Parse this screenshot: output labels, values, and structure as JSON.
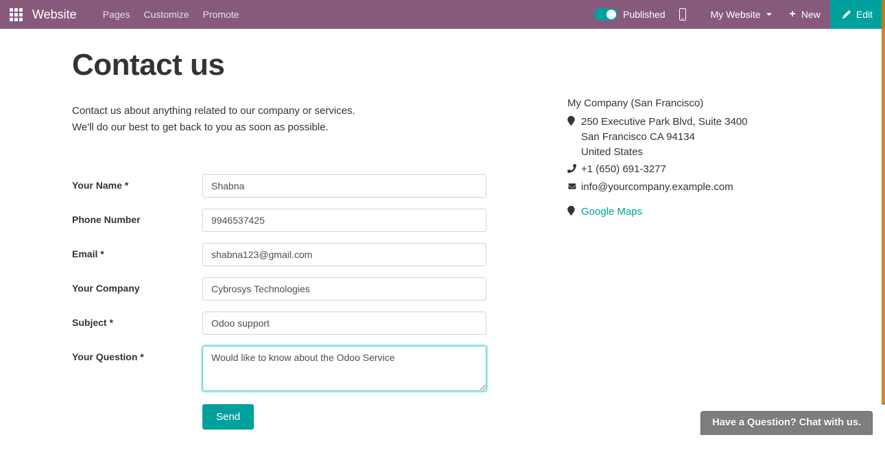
{
  "navbar": {
    "brand": "Website",
    "items": [
      "Pages",
      "Customize",
      "Promote"
    ],
    "published_label": "Published",
    "site_dropdown": "My Website",
    "new_label": "New",
    "edit_label": "Edit"
  },
  "page": {
    "title": "Contact us",
    "intro_line1": "Contact us about anything related to our company or services.",
    "intro_line2": "We'll do our best to get back to you as soon as possible."
  },
  "form": {
    "fields": {
      "name": {
        "label": "Your Name *",
        "value": "Shabna"
      },
      "phone": {
        "label": "Phone Number",
        "value": "9946537425"
      },
      "email": {
        "label": "Email *",
        "value": "shabna123@gmail.com"
      },
      "company": {
        "label": "Your Company",
        "value": "Cybrosys Technologies"
      },
      "subject": {
        "label": "Subject *",
        "value": "Odoo support"
      },
      "question": {
        "label": "Your Question *",
        "value": "Would like to know about the Odoo Service"
      }
    },
    "send_label": "Send"
  },
  "company": {
    "name": "My Company (San Francisco)",
    "address_line1": "250 Executive Park Blvd, Suite 3400",
    "address_line2": "San Francisco CA 94134",
    "address_line3": "United States",
    "phone": "+1 (650) 691-3277",
    "email": "info@yourcompany.example.com",
    "maps_label": "Google Maps"
  },
  "chat": {
    "label": "Have a Question? Chat with us."
  }
}
